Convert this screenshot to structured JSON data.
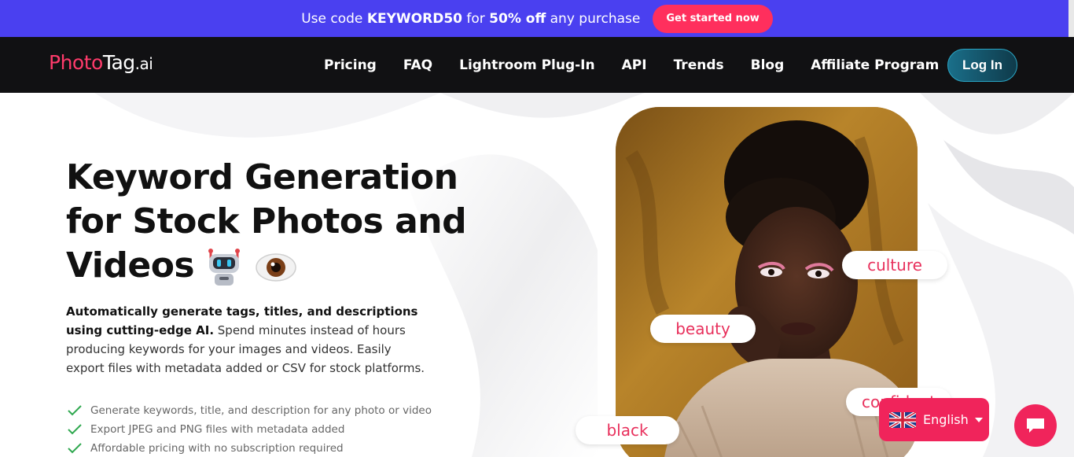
{
  "promo": {
    "text_prefix": "Use code ",
    "code": "KEYWORD50",
    "text_mid": " for ",
    "discount": "50% off",
    "text_suffix": " any purchase",
    "cta": "Get started now"
  },
  "nav": {
    "logo_photo": "Photo",
    "logo_tag": "Tag",
    "logo_ai": ".ai",
    "links": [
      "Pricing",
      "FAQ",
      "Lightroom Plug-In",
      "API",
      "Trends",
      "Blog",
      "Affiliate Program"
    ],
    "login": "Log In"
  },
  "hero": {
    "headline": "Keyword Generation for Stock Photos and Videos",
    "emoji_icons": [
      "robot-icon",
      "eye-icon"
    ],
    "desc_bold": "Automatically generate tags, titles, and descriptions using cutting-edge AI.",
    "desc_rest": " Spend minutes instead of hours producing keywords for your images and videos. Easily export files with metadata added or CSV for stock platforms.",
    "features": [
      "Generate keywords, title, and description for any photo or video",
      "Export JPEG and PNG files with metadata added",
      "Affordable pricing with no subscription required"
    ]
  },
  "photo_tags": {
    "culture": "culture",
    "beauty": "beauty",
    "confident": "confident",
    "black": "black"
  },
  "language": {
    "selected": "English",
    "flag_icon": "uk-flag-icon"
  },
  "chat": {
    "icon": "chat-icon"
  },
  "colors": {
    "accent": "#ff2f5d",
    "promo_bg": "#4a40f0",
    "nav_bg": "#111113",
    "tag_text": "#e8305c"
  }
}
